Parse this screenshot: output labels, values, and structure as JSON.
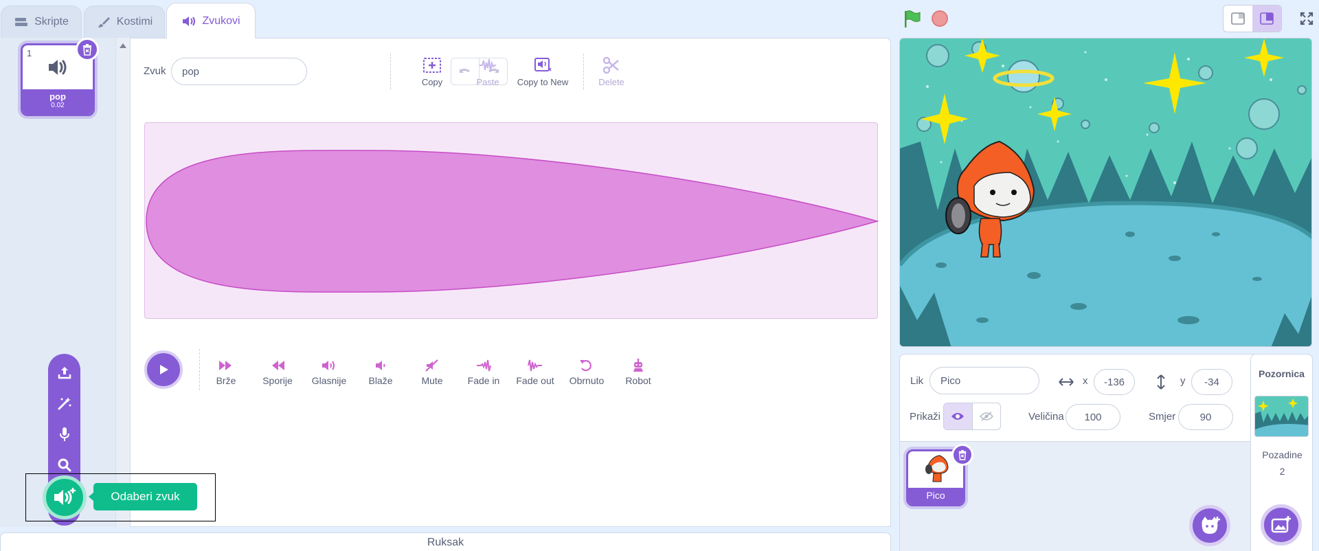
{
  "tabs": [
    {
      "label": "Skripte",
      "icon": "code-icon"
    },
    {
      "label": "Kostimi",
      "icon": "brush-icon"
    },
    {
      "label": "Zvukovi",
      "icon": "sound-icon"
    }
  ],
  "sound_list": {
    "items": [
      {
        "index": "1",
        "name": "pop",
        "duration": "0.02"
      }
    ]
  },
  "add_sound_menu": {
    "items": [
      "upload-sound-icon",
      "surprise-icon",
      "record-icon",
      "search-icon"
    ],
    "tooltip": "Odaberi zvuk"
  },
  "editor": {
    "sound_label": "Zvuk",
    "sound_name": "pop",
    "tools": [
      {
        "label": "Copy",
        "enabled": true
      },
      {
        "label": "Paste",
        "enabled": false
      },
      {
        "label": "Copy to New",
        "enabled": true
      },
      {
        "label": "Delete",
        "enabled": false
      }
    ],
    "effects": [
      "Brže",
      "Sporije",
      "Glasnije",
      "Blaže",
      "Mute",
      "Fade in",
      "Fade out",
      "Obrnuto",
      "Robot"
    ]
  },
  "backpack": {
    "label": "Ruksak"
  },
  "sprite_info": {
    "sprite_label": "Lik",
    "sprite_name": "Pico",
    "x_label": "x",
    "x_value": "-136",
    "y_label": "y",
    "y_value": "-34",
    "show_label": "Prikaži",
    "size_label": "Veličina",
    "size_value": "100",
    "direction_label": "Smjer",
    "direction_value": "90"
  },
  "sprites": [
    {
      "name": "Pico"
    }
  ],
  "stage_pane": {
    "title": "Pozornica",
    "backdrops_label": "Pozadine",
    "backdrops_count": "2"
  },
  "colors": {
    "accent": "#855cd6",
    "green": "#0fbd8c",
    "sound_magenta": "#cf63cf",
    "background": "#e5f0ff"
  }
}
